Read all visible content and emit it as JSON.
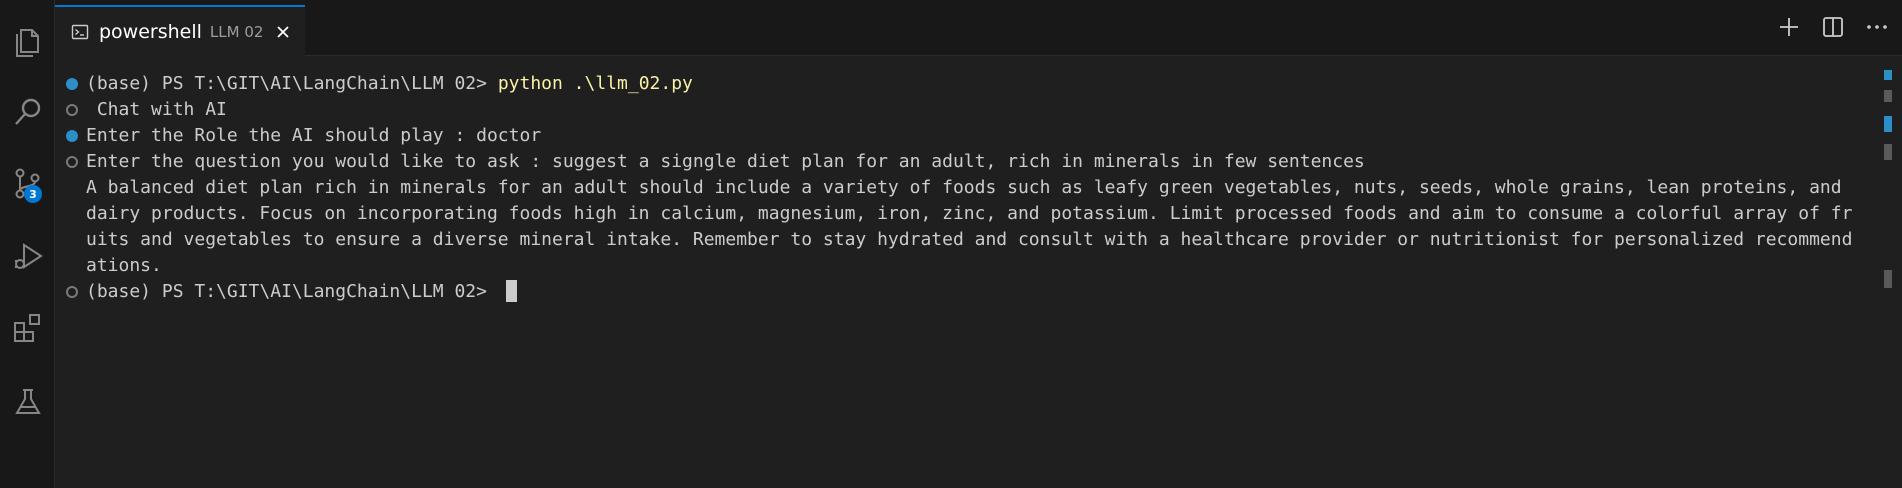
{
  "tab": {
    "title": "powershell",
    "description": "LLM 02"
  },
  "activity_bar": {
    "source_control_badge": "3"
  },
  "terminal": {
    "lines": [
      {
        "prefix": "(base) PS T:\\GIT\\AI\\LangChain\\LLM 02> ",
        "command": "python .\\llm_02.py"
      },
      {
        "text": " Chat with AI"
      },
      {
        "text": "Enter the Role the AI should play : doctor"
      },
      {
        "text": "Enter the question you would like to ask : suggest a signgle diet plan for an adult, rich in minerals in few sentences"
      },
      {
        "text": "A balanced diet plan rich in minerals for an adult should include a variety of foods such as leafy green vegetables, nuts, seeds, whole grains, lean proteins, and"
      },
      {
        "text": "dairy products. Focus on incorporating foods high in calcium, magnesium, iron, zinc, and potassium. Limit processed foods and aim to consume a colorful array of fr"
      },
      {
        "text": "uits and vegetables to ensure a diverse mineral intake. Remember to stay hydrated and consult with a healthcare provider or nutritionist for personalized recommend"
      },
      {
        "text": "ations."
      },
      {
        "prompt": "(base) PS T:\\GIT\\AI\\LangChain\\LLM 02> "
      }
    ]
  },
  "colors": {
    "accent": "#0078d4",
    "command": "#f9f1a5",
    "decoration_filled": "#2c8fc7"
  },
  "icons": {
    "activity": [
      "explorer-icon",
      "search-icon",
      "source-control-icon",
      "run-debug-icon",
      "extensions-icon",
      "testing-icon"
    ],
    "tab": [
      "terminal-icon",
      "close-icon"
    ],
    "actions": [
      "plus-icon",
      "split-terminal-icon",
      "more-icon"
    ]
  }
}
